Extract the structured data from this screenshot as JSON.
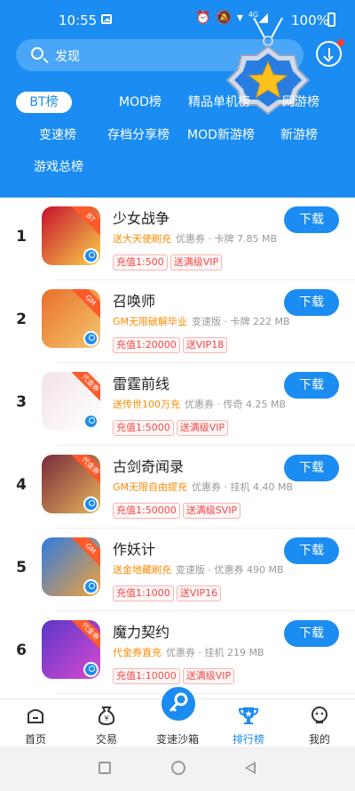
{
  "status_bar": {
    "time": "10:55",
    "battery": "100%",
    "signal": "4G"
  },
  "search": {
    "placeholder": "发现"
  },
  "tabs": [
    {
      "label": "BT榜",
      "active": true
    },
    {
      "label": "MOD榜"
    },
    {
      "label": "精品单机榜"
    },
    {
      "label": "网游榜"
    },
    {
      "label": "变速榜"
    },
    {
      "label": "存档分享榜"
    },
    {
      "label": "MOD新游榜"
    },
    {
      "label": "新游榜"
    },
    {
      "label": "游戏总榜"
    }
  ],
  "download_label": "下载",
  "games": [
    {
      "rank": "1",
      "name": "少女战争",
      "promo": "送大天使刷充",
      "tags": "优惠券 · 卡牌 7.85 MB",
      "badges": [
        "充值1:500",
        "送满级VIP"
      ],
      "icon_corner": "BT",
      "icon_colors": [
        "#c8102e",
        "#f7d24a"
      ]
    },
    {
      "rank": "2",
      "name": "召唤师",
      "promo": "GM无限破解毕业",
      "tags": "变速版 · 卡牌 222 MB",
      "badges": [
        "充值1:20000",
        "送VIP18"
      ],
      "icon_corner": "GM",
      "icon_colors": [
        "#e86f2c",
        "#f4c66c"
      ]
    },
    {
      "rank": "3",
      "name": "雷霆前线",
      "promo": "送传世100万充",
      "tags": "优惠券 · 传奇 4.25 MB",
      "badges": [
        "充值1:5000",
        "送满级VIP"
      ],
      "icon_corner": "代金券",
      "icon_colors": [
        "#f3e3e7",
        "#ffffff"
      ]
    },
    {
      "rank": "4",
      "name": "古剑奇闻录",
      "promo": "GM无限自由提充",
      "tags": "优惠券 · 挂机 4.40 MB",
      "badges": [
        "充值1:50000",
        "送满级SVIP"
      ],
      "icon_corner": "代金券",
      "icon_colors": [
        "#7a2a3c",
        "#e6b35a"
      ]
    },
    {
      "rank": "5",
      "name": "作妖计",
      "promo": "送金地藏刷充",
      "tags": "变速版 · 优惠券 490 MB",
      "badges": [
        "充值1:1000",
        "送VIP16"
      ],
      "icon_corner": "GM",
      "icon_colors": [
        "#2f7be0",
        "#f2a23a"
      ]
    },
    {
      "rank": "6",
      "name": "魔力契约",
      "promo": "代金券直充",
      "tags": "优惠券 · 挂机 219 MB",
      "badges": [
        "充值1:10000",
        "送满级VIP"
      ],
      "icon_corner": "代金券",
      "icon_colors": [
        "#5a36c8",
        "#d84ad0"
      ]
    }
  ],
  "bottom_nav": [
    {
      "label": "首页"
    },
    {
      "label": "交易"
    },
    {
      "label": "变速沙箱"
    },
    {
      "label": "排行榜",
      "active": true
    },
    {
      "label": "我的"
    }
  ],
  "colors": {
    "primary": "#1a8cf2",
    "promo": "#ff8a00",
    "badge": "#f04a4a"
  }
}
